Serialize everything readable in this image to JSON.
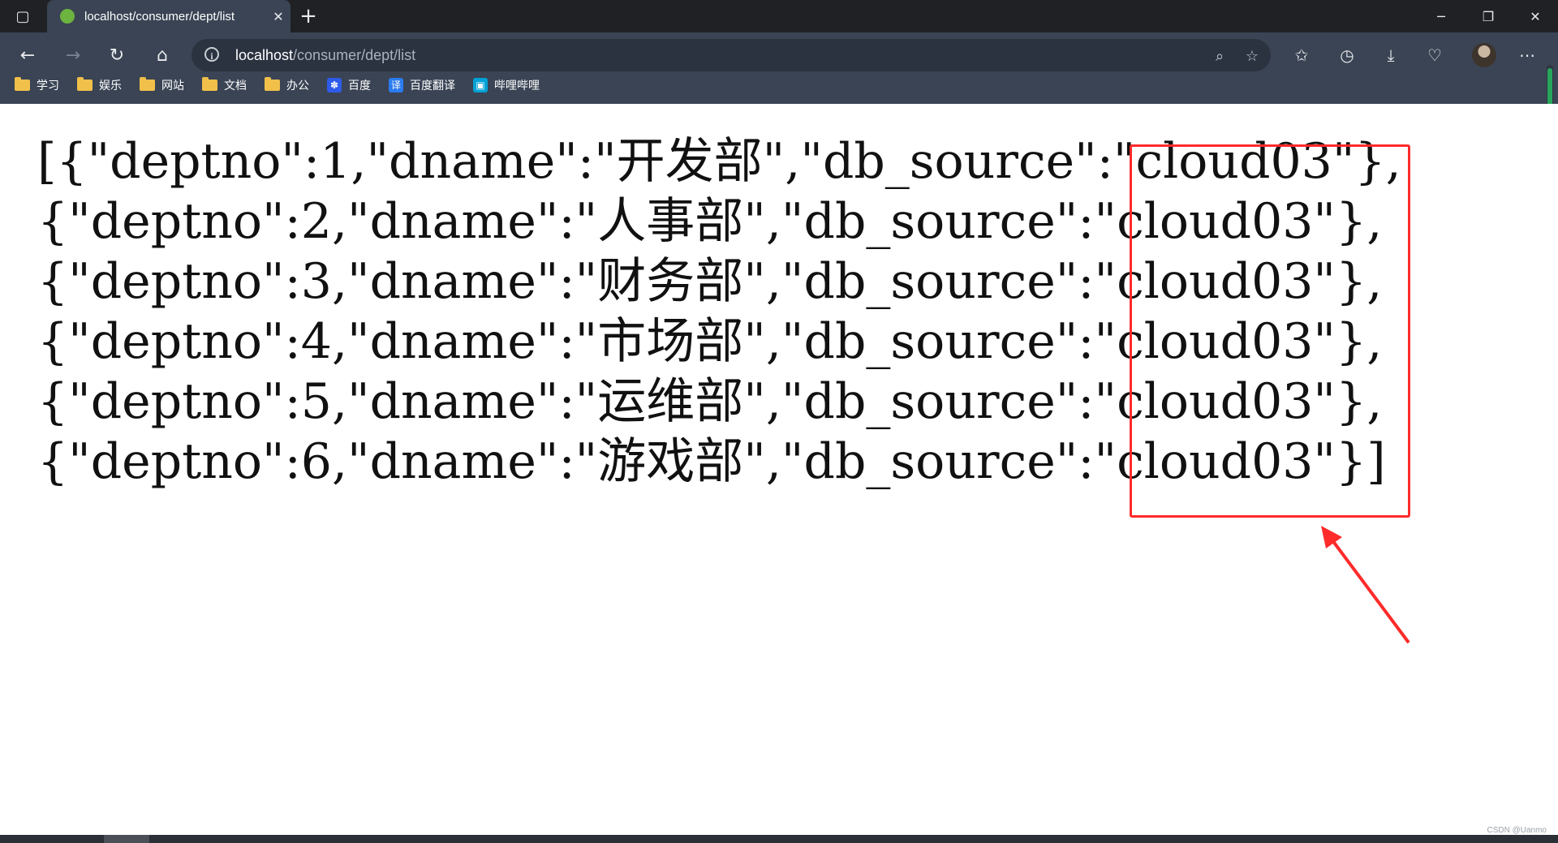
{
  "browser": {
    "tab_title": "localhost/consumer/dept/list",
    "new_tab_symbol": "+",
    "url_host": "localhost",
    "url_path": "/consumer/dept/list",
    "window_controls": [
      "─",
      "❐",
      "✕"
    ],
    "favicon_color": "#6db33f"
  },
  "bookmarks": [
    {
      "label": "学习",
      "icon": "folder-icon"
    },
    {
      "label": "娱乐",
      "icon": "folder-icon"
    },
    {
      "label": "网站",
      "icon": "folder-icon"
    },
    {
      "label": "文档",
      "icon": "folder-icon"
    },
    {
      "label": "办公",
      "icon": "folder-icon"
    },
    {
      "label": "百度",
      "icon": "baidu-icon"
    },
    {
      "label": "百度翻译",
      "icon": "baidu-translate-icon"
    },
    {
      "label": "哔哩哔哩",
      "icon": "bilibili-icon"
    }
  ],
  "json_lines": [
    "[{\"deptno\":1,\"dname\":\"开发部\",\"db_source\":\"cloud03\"},",
    "{\"deptno\":2,\"dname\":\"人事部\",\"db_source\":\"cloud03\"},",
    "{\"deptno\":3,\"dname\":\"财务部\",\"db_source\":\"cloud03\"},",
    "{\"deptno\":4,\"dname\":\"市场部\",\"db_source\":\"cloud03\"},",
    "{\"deptno\":5,\"dname\":\"运维部\",\"db_source\":\"cloud03\"},",
    "{\"deptno\":6,\"dname\":\"游戏部\",\"db_source\":\"cloud03\"}]"
  ],
  "annotation": {
    "color": "#ff2a2a"
  },
  "watermark": "CSDN @Uanmo"
}
